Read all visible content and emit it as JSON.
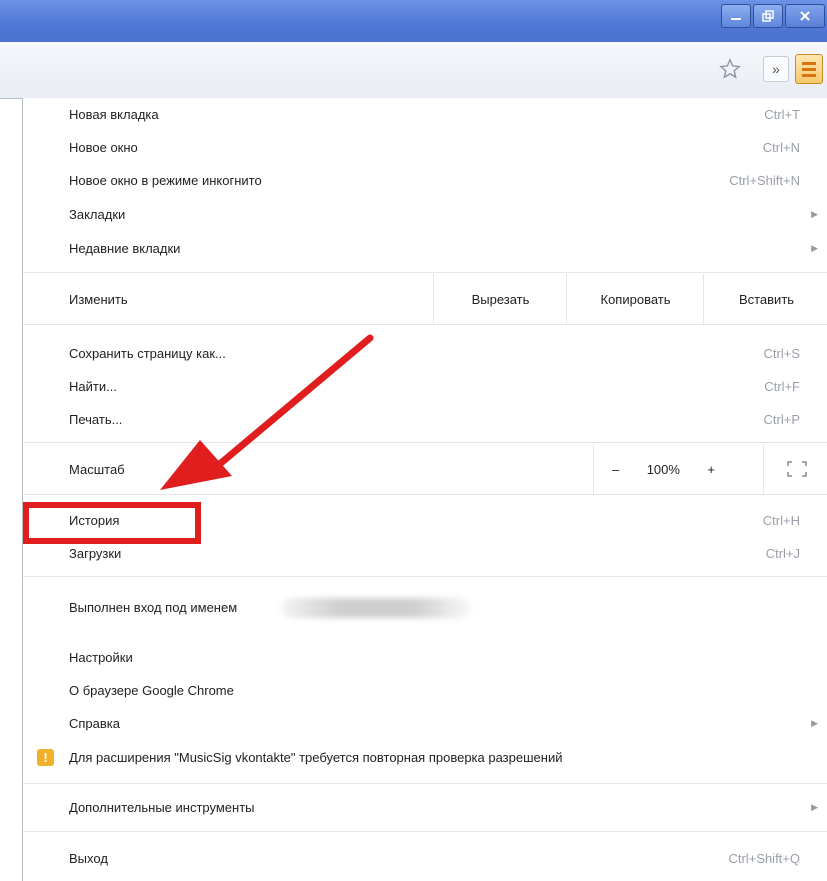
{
  "window": {
    "minimize_icon": "minimize-icon",
    "restore_icon": "restore-icon",
    "close_icon": "close-icon"
  },
  "toolbar": {
    "bookmark_icon": "star-icon",
    "overflow_label": "»",
    "menu_icon": "hamburger-menu-icon"
  },
  "menu": {
    "new_tab": {
      "label": "Новая вкладка",
      "shortcut": "Ctrl+T"
    },
    "new_window": {
      "label": "Новое окно",
      "shortcut": "Ctrl+N"
    },
    "incognito": {
      "label": "Новое окно в режиме инкогнито",
      "shortcut": "Ctrl+Shift+N"
    },
    "bookmarks": {
      "label": "Закладки"
    },
    "recent_tabs": {
      "label": "Недавние вкладки"
    },
    "edit": {
      "label": "Изменить",
      "cut": "Вырезать",
      "copy": "Копировать",
      "paste": "Вставить"
    },
    "save_page": {
      "label": "Сохранить страницу как...",
      "shortcut": "Ctrl+S"
    },
    "find": {
      "label": "Найти...",
      "shortcut": "Ctrl+F"
    },
    "print": {
      "label": "Печать...",
      "shortcut": "Ctrl+P"
    },
    "zoom": {
      "label": "Масштаб",
      "minus": "–",
      "value": "100%",
      "plus": "+",
      "fullscreen_icon": "fullscreen-icon"
    },
    "history": {
      "label": "История",
      "shortcut": "Ctrl+H"
    },
    "downloads": {
      "label": "Загрузки",
      "shortcut": "Ctrl+J"
    },
    "signed_in": {
      "label": "Выполнен вход под именем"
    },
    "settings": {
      "label": "Настройки"
    },
    "about": {
      "label": "О браузере Google Chrome"
    },
    "help": {
      "label": "Справка"
    },
    "extension_warning": {
      "label": "Для расширения \"MusicSig vkontakte\" требуется повторная проверка разрешений",
      "icon": "warning-icon"
    },
    "more_tools": {
      "label": "Дополнительные инструменты"
    },
    "exit": {
      "label": "Выход",
      "shortcut": "Ctrl+Shift+Q"
    }
  },
  "colors": {
    "titlebar": "#4f78d6",
    "menu_button": "#f6c968",
    "annotation": "#e01e1e",
    "warning": "#f2b12a"
  }
}
